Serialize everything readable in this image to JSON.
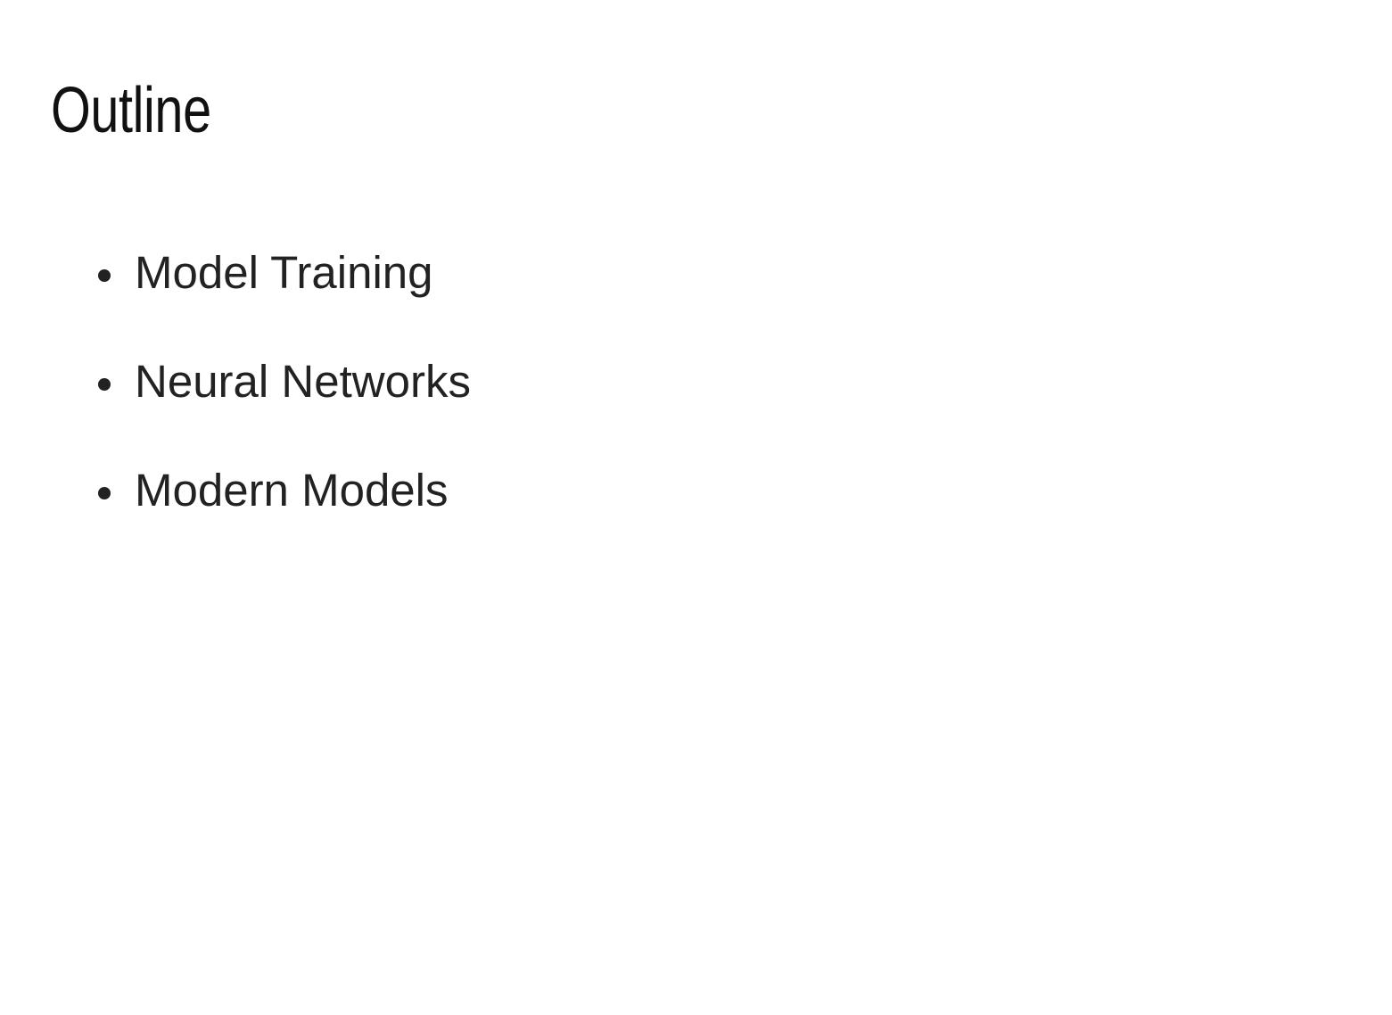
{
  "slide": {
    "title": "Outline",
    "bullets": [
      "Model Training",
      "Neural Networks",
      "Modern Models"
    ]
  },
  "colors": {
    "background": "#ffffff",
    "title_text": "#111111",
    "body_text": "#222222"
  }
}
